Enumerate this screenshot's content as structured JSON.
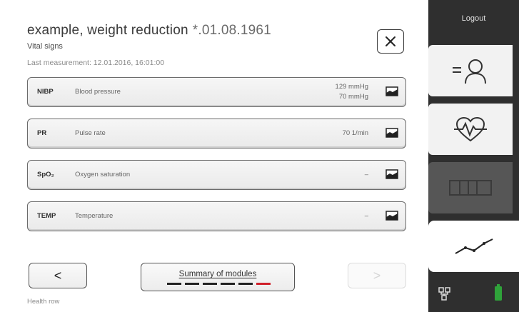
{
  "header": {
    "patient_name": "example, weight reduction",
    "patient_dob": "*.01.08.1961",
    "subtitle": "Vital signs",
    "last_measurement": "Last measurement: 12.01.2016, 16:01:00"
  },
  "vitals": [
    {
      "abbr": "NIBP",
      "name": "Blood pressure",
      "value_line1": "129 mmHg",
      "value_line2": "70 mmHg"
    },
    {
      "abbr": "PR",
      "name": "Pulse rate",
      "value": "70 1/min"
    },
    {
      "abbr": "SpO₂",
      "name": "Oxygen saturation",
      "value": "–"
    },
    {
      "abbr": "TEMP",
      "name": "Temperature",
      "value": "–"
    }
  ],
  "nav": {
    "back_glyph": "<",
    "back_label": "Health row",
    "summary_label": "Summary of modules",
    "forward_glyph": ">",
    "active_module_index": 5
  },
  "sidebar": {
    "logout_label": "Logout",
    "tabs": [
      "patient-list-icon",
      "vital-signs-icon",
      "device-icon",
      "trend-icon"
    ],
    "active_tab": "trend-icon"
  },
  "colors": {
    "accent_red": "#d0202a",
    "sidebar_bg": "#2f2f2f",
    "battery_green": "#2fa33a"
  }
}
